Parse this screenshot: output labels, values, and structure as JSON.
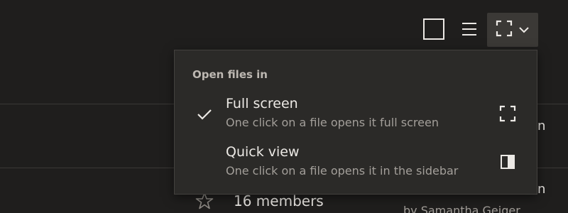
{
  "toolbar": {
    "grid_view_icon": "grid-view-icon",
    "list_view_icon": "list-view-icon",
    "open_mode_icon": "fullscreen-icon",
    "open_mode_chevron": "chevron-down-icon"
  },
  "menu": {
    "heading": "Open files in",
    "options": [
      {
        "title": "Full screen",
        "description": "One click on a file opens it full screen",
        "icon": "fullscreen-icon",
        "selected": true
      },
      {
        "title": "Quick view",
        "description": "One click on a file opens it in the sidebar",
        "icon": "sidebar-panel-icon",
        "selected": false
      }
    ]
  },
  "background_list": {
    "row_cutoff_a": "n",
    "row_cutoff_b": "n",
    "row_glyph": "/ /",
    "members": "16 members",
    "byline": "by Samantha Geiger"
  },
  "colors": {
    "background": "#1f1e1d",
    "menu_background": "#2b2a28",
    "active_button": "#3b3936",
    "text_primary": "#ece9e5",
    "text_secondary": "#a39f9a"
  }
}
